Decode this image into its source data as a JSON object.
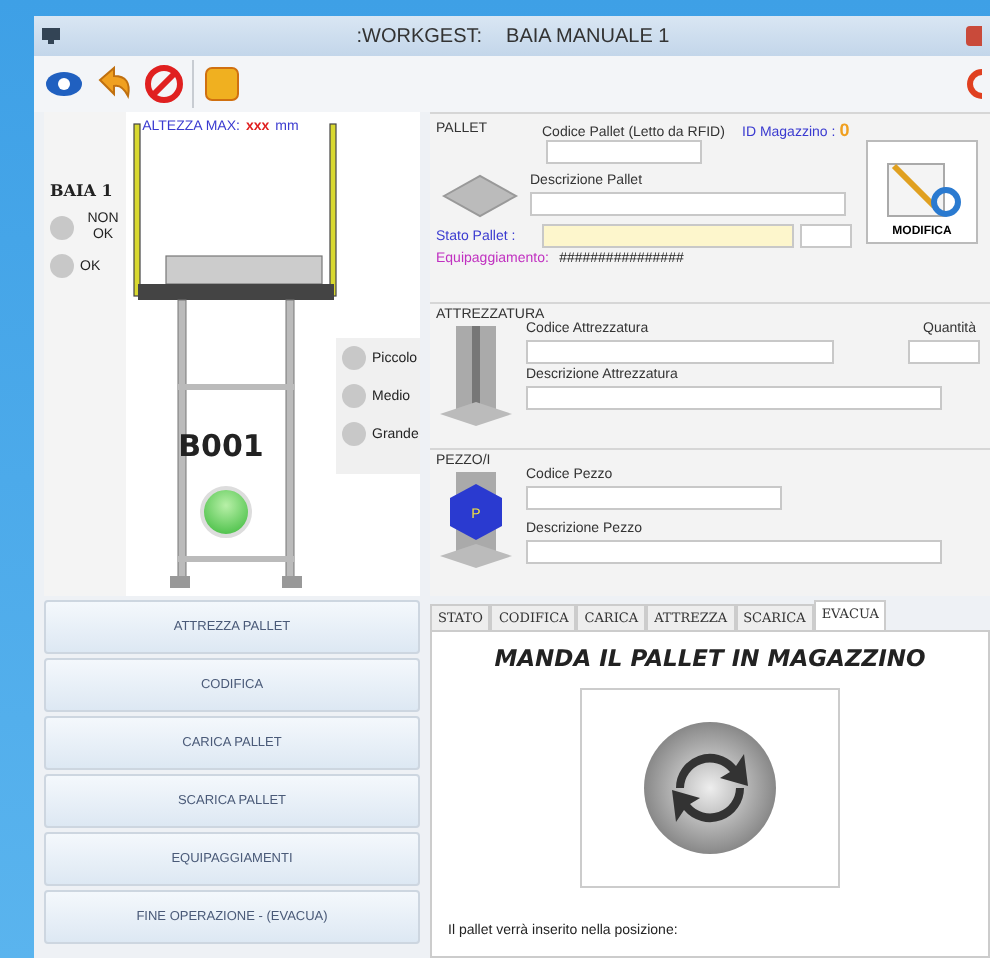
{
  "window": {
    "app": ":WORKGEST:",
    "title": "BAIA MANUALE 1"
  },
  "bay": {
    "label": "BAIA 1",
    "height_label": "ALTEZZA MAX:",
    "height_value": "xxx",
    "height_unit": "mm",
    "code": "B001",
    "lamp_on": true,
    "lights": [
      {
        "label": "NON OK",
        "on": false
      },
      {
        "label": "OK",
        "on": false
      }
    ],
    "sizes": [
      {
        "label": "Piccolo",
        "selected": false
      },
      {
        "label": "Medio",
        "selected": false
      },
      {
        "label": "Grande",
        "selected": false
      }
    ]
  },
  "pallet": {
    "section": "PALLET",
    "code_label": "Codice Pallet (Letto da RFID)",
    "id_label": "ID Magazzino :",
    "id_value": "0",
    "desc_label": "Descrizione Pallet",
    "state_label": "Stato Pallet :",
    "equip_label": "Equipaggiamento:",
    "equip_value": "################",
    "modify_button": "MODIFICA"
  },
  "tooling": {
    "section": "ATTREZZATURA",
    "code_label": "Codice Attrezzatura",
    "qty_label": "Quantità",
    "desc_label": "Descrizione Attrezzatura"
  },
  "piece": {
    "section": "PEZZO/I",
    "badge": "P",
    "code_label": "Codice Pezzo",
    "desc_label": "Descrizione Pezzo"
  },
  "actions": [
    "ATTREZZA PALLET",
    "CODIFICA",
    "CARICA PALLET",
    "SCARICA PALLET",
    "EQUIPAGGIAMENTI",
    "FINE OPERAZIONE - (EVACUA)"
  ],
  "tabs": [
    {
      "label": "STATO",
      "selected": false
    },
    {
      "label": "CODIFICA",
      "selected": false
    },
    {
      "label": "CARICA",
      "selected": false
    },
    {
      "label": "ATTREZZA",
      "selected": false
    },
    {
      "label": "SCARICA",
      "selected": false
    },
    {
      "label": "EVACUA",
      "selected": true
    }
  ],
  "tab_content": {
    "heading": "MANDA IL PALLET IN MAGAZZINO",
    "message": "Il pallet verrà inserito nella posizione:"
  }
}
